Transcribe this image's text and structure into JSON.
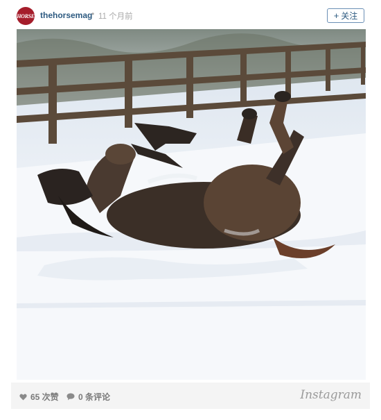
{
  "post": {
    "avatar_text": "HORSE",
    "username": "thehorsemag",
    "separator": "•",
    "time": "11 个月前",
    "follow_label": "关注",
    "follow_icon": "plus-icon",
    "likes_label": "65 次赞",
    "comments_label": "0 条评论",
    "brand": "Instagram"
  },
  "colors": {
    "username": "#2d5a80",
    "avatar": "#a51d2b",
    "muted": "#a9a9a9"
  }
}
